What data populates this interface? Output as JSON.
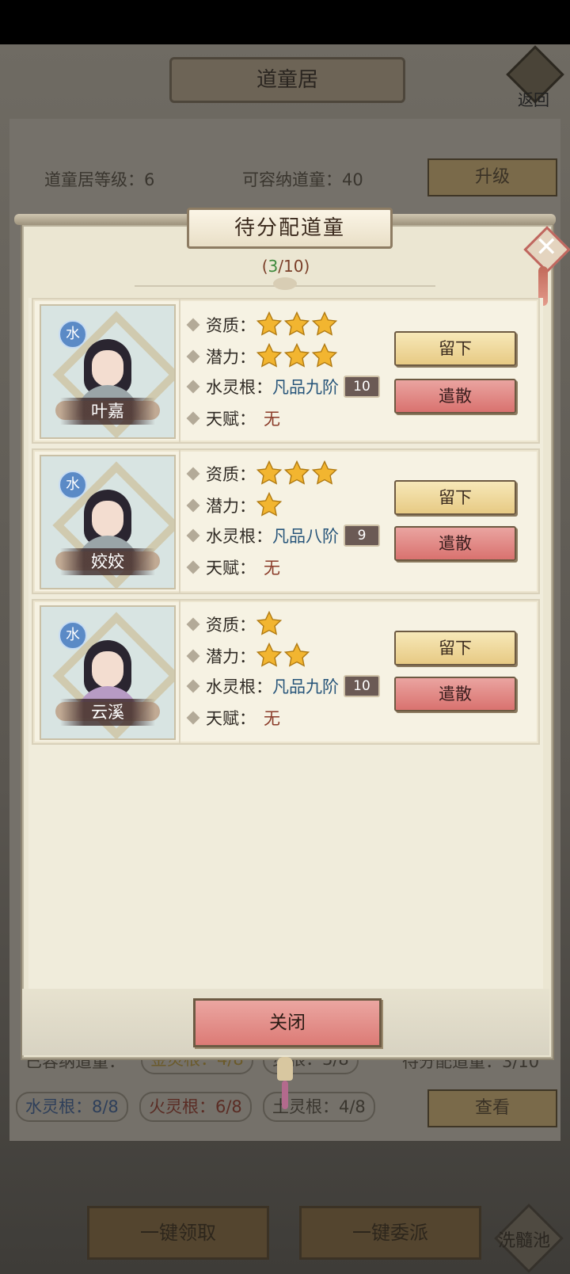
{
  "background": {
    "title": "道童居",
    "back_label": "返回",
    "level_text": "道童居等级：6",
    "capacity_text": "可容纳道童：40",
    "upgrade_label": "升级",
    "stats_row1": {
      "label": "已容纳道童：",
      "gold": "金灵根：4/8",
      "wood": "灵根：3/8",
      "pending": "待分配道童：3/10"
    },
    "stats_row2": {
      "water": "水灵根：8/8",
      "fire": "火灵根：6/8",
      "earth": "土灵根：4/8",
      "view_label": "查看"
    },
    "bottom_buttons": [
      "一键领取",
      "一键委派"
    ],
    "pool_label": "洗髓池"
  },
  "dialog": {
    "title": "待分配道童",
    "count_open": "(",
    "count_current": "3",
    "count_rest": "/10)",
    "close_label": "关闭",
    "labels": {
      "aptitude": "资质：",
      "potential": "潜力：",
      "root": "水灵根：",
      "talent": "天赋："
    },
    "keep_label": "留下",
    "dismiss_label": "遣散",
    "disciples": [
      {
        "name": "叶嘉",
        "element": "水",
        "aptitude_stars": 3,
        "potential_stars": 3,
        "root_value": "凡品九阶",
        "root_level": "10",
        "talent": "无"
      },
      {
        "name": "姣姣",
        "element": "水",
        "aptitude_stars": 3,
        "potential_stars": 1,
        "root_value": "凡品八阶",
        "root_level": "9",
        "talent": "无"
      },
      {
        "name": "云溪",
        "element": "水",
        "aptitude_stars": 1,
        "potential_stars": 2,
        "root_value": "凡品九阶",
        "root_level": "10",
        "talent": "无"
      }
    ]
  },
  "colors": {
    "accent_gold": "#e7ca84",
    "dismiss_red": "#d9726f",
    "water_blue": "#5b8ac6",
    "star": "#f2b530"
  }
}
